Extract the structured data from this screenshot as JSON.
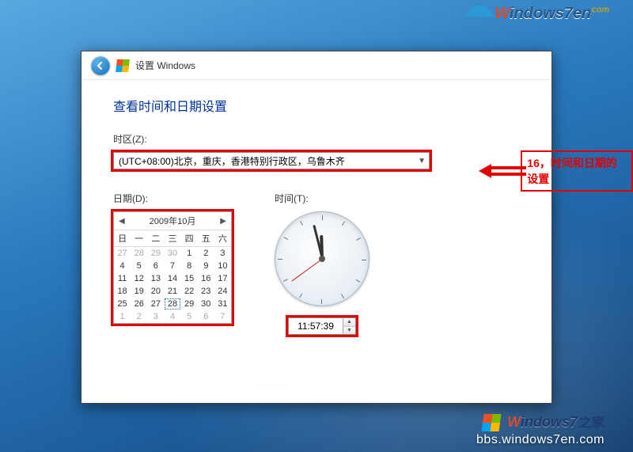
{
  "watermark_top": {
    "brand": "Windows7en",
    "tld": "com"
  },
  "watermark_bottom": {
    "brand": "Windows7",
    "zhijia": "之家",
    "url": "bbs.windows7en.com"
  },
  "titlebar": {
    "text": "设置 Windows"
  },
  "heading": "查看时间和日期设置",
  "timezone": {
    "label": "时区(Z):",
    "selected": "(UTC+08:00)北京，重庆，香港特别行政区，乌鲁木齐"
  },
  "annotation": {
    "text": "16，时间和日期的设置"
  },
  "date": {
    "label": "日期(D):",
    "month_title": "2009年10月",
    "dow": [
      "日",
      "一",
      "二",
      "三",
      "四",
      "五",
      "六"
    ],
    "leading_other": [
      27,
      28,
      29,
      30
    ],
    "days": [
      1,
      2,
      3,
      4,
      5,
      6,
      7,
      8,
      9,
      10,
      11,
      12,
      13,
      14,
      15,
      16,
      17,
      18,
      19,
      20,
      21,
      22,
      23,
      24,
      25,
      26,
      27,
      28,
      29,
      30,
      31
    ],
    "trailing_other": [
      1,
      2,
      3,
      4,
      5,
      6,
      7
    ],
    "selected_day": 28
  },
  "time": {
    "label": "时间(T):",
    "value": "11:57:39",
    "hour": 11,
    "minute": 57,
    "second": 39
  },
  "colors": {
    "highlight": "#e30000",
    "heading": "#003399"
  }
}
